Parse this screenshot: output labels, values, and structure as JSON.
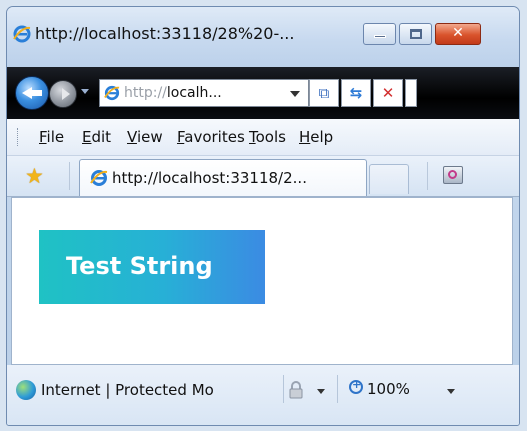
{
  "window": {
    "title": "http://localhost:33118/28%20-..."
  },
  "navigation": {
    "address_protocol": "http://",
    "address_host": "localh...",
    "icons": [
      "back-arrow-icon",
      "forward-arrow-icon",
      "compatibility-view-icon",
      "refresh-icon",
      "stop-icon"
    ]
  },
  "menu": {
    "items": [
      "File",
      "Edit",
      "View",
      "Favorites",
      "Tools",
      "Help"
    ]
  },
  "tabs": {
    "active_tab_label": "http://localhost:33118/2..."
  },
  "content": {
    "box_text": "Test String",
    "box_gradient": [
      "#1fc2c4",
      "#3b8be3"
    ]
  },
  "status": {
    "zone_text": "Internet | Protected Mo",
    "zoom_text": "100%"
  }
}
